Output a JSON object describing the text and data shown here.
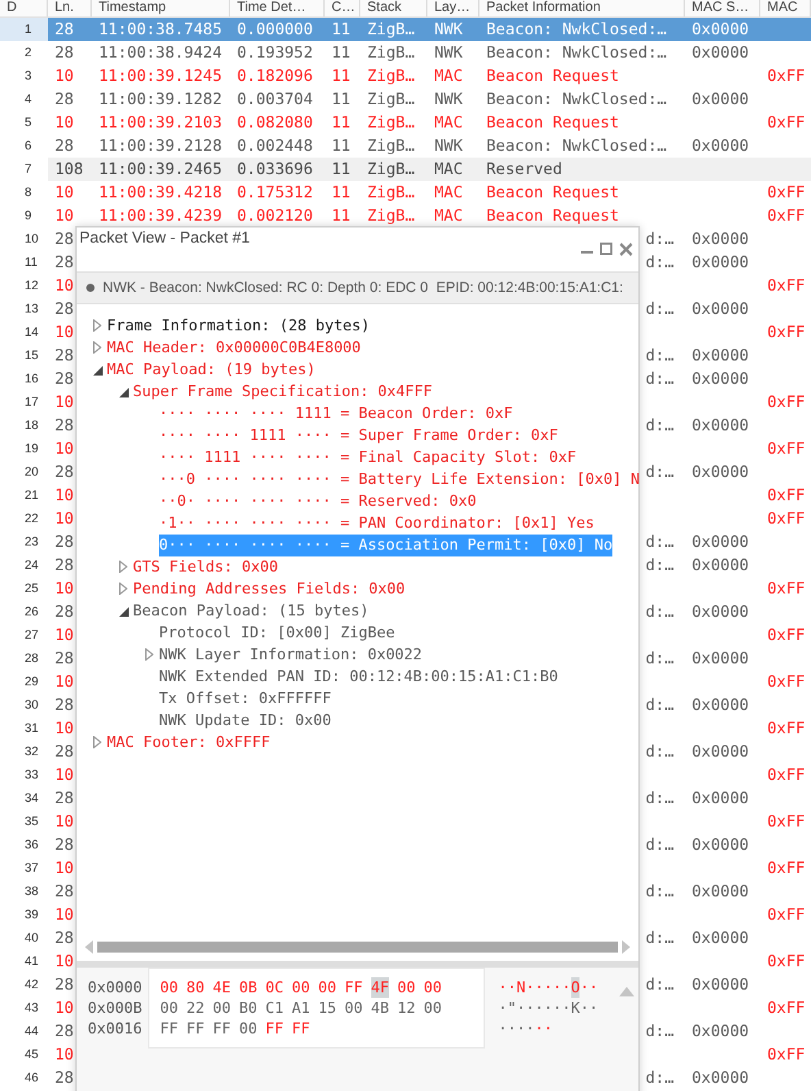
{
  "table": {
    "columns": [
      "D",
      "Ln.",
      "Timestamp",
      "Time Det…",
      "C…",
      "Stack",
      "Lay…",
      "Packet Information",
      "MAC S…",
      "MAC"
    ],
    "rows": [
      {
        "no": "1",
        "length": "28",
        "timestamp": "11:00:38.7485",
        "delta": "0.000000",
        "channel": "11",
        "stack": "ZigB…",
        "layer": "NWK",
        "info": "Beacon: NwkClosed:…",
        "mac_src": "0x0000",
        "kind": "beacon",
        "selected": true,
        "hovered": false
      },
      {
        "no": "2",
        "length": "28",
        "timestamp": "11:00:38.9424",
        "delta": "0.193952",
        "channel": "11",
        "stack": "ZigB…",
        "layer": "NWK",
        "info": "Beacon: NwkClosed:…",
        "mac_src": "0x0000",
        "kind": "beacon",
        "selected": false,
        "hovered": false
      },
      {
        "no": "3",
        "length": "10",
        "timestamp": "11:00:39.1245",
        "delta": "0.182096",
        "channel": "11",
        "stack": "ZigB…",
        "layer": "MAC",
        "info": "Beacon Request",
        "mac_dst": "0xFF",
        "kind": "request",
        "selected": false,
        "hovered": false
      },
      {
        "no": "4",
        "length": "28",
        "timestamp": "11:00:39.1282",
        "delta": "0.003704",
        "channel": "11",
        "stack": "ZigB…",
        "layer": "NWK",
        "info": "Beacon: NwkClosed:…",
        "mac_src": "0x0000",
        "kind": "beacon",
        "selected": false,
        "hovered": false
      },
      {
        "no": "5",
        "length": "10",
        "timestamp": "11:00:39.2103",
        "delta": "0.082080",
        "channel": "11",
        "stack": "ZigB…",
        "layer": "MAC",
        "info": "Beacon Request",
        "mac_dst": "0xFF",
        "kind": "request",
        "selected": false,
        "hovered": false
      },
      {
        "no": "6",
        "length": "28",
        "timestamp": "11:00:39.2128",
        "delta": "0.002448",
        "channel": "11",
        "stack": "ZigB…",
        "layer": "NWK",
        "info": "Beacon: NwkClosed:…",
        "mac_src": "0x0000",
        "kind": "beacon",
        "selected": false,
        "hovered": false
      },
      {
        "no": "7",
        "length": "108",
        "timestamp": "11:00:39.2465",
        "delta": "0.033696",
        "channel": "11",
        "stack": "ZigB…",
        "layer": "MAC",
        "info": "Reserved",
        "kind": "other",
        "selected": false,
        "hovered": true
      },
      {
        "no": "8",
        "length": "10",
        "timestamp": "11:00:39.4218",
        "delta": "0.175312",
        "channel": "11",
        "stack": "ZigB…",
        "layer": "MAC",
        "info": "Beacon Request",
        "mac_dst": "0xFF",
        "kind": "request",
        "selected": false,
        "hovered": false
      },
      {
        "no": "9",
        "length": "10",
        "timestamp": "11:00:39.4239",
        "delta": "0.002120",
        "channel": "11",
        "stack": "ZigB…",
        "layer": "MAC",
        "info": "Beacon Request",
        "mac_dst": "0xFF",
        "kind": "request",
        "selected": false,
        "hovered": false
      },
      {
        "no": "10",
        "length": "28",
        "info": "d:…",
        "mac_src": "0x0000",
        "kind": "beacon",
        "selected": false,
        "hovered": false
      },
      {
        "no": "11",
        "length": "28",
        "info": "d:…",
        "mac_src": "0x0000",
        "kind": "beacon",
        "selected": false,
        "hovered": false
      },
      {
        "no": "12",
        "length": "10",
        "mac_dst": "0xFF",
        "kind": "request",
        "selected": false,
        "hovered": false
      },
      {
        "no": "13",
        "length": "28",
        "info": "d:…",
        "mac_src": "0x0000",
        "kind": "beacon",
        "selected": false,
        "hovered": false
      },
      {
        "no": "14",
        "length": "10",
        "mac_dst": "0xFF",
        "kind": "request",
        "selected": false,
        "hovered": false
      },
      {
        "no": "15",
        "length": "28",
        "info": "d:…",
        "mac_src": "0x0000",
        "kind": "beacon",
        "selected": false,
        "hovered": false
      },
      {
        "no": "16",
        "length": "28",
        "info": "d:…",
        "mac_src": "0x0000",
        "kind": "beacon",
        "selected": false,
        "hovered": false
      },
      {
        "no": "17",
        "length": "10",
        "mac_dst": "0xFF",
        "kind": "request",
        "selected": false,
        "hovered": false
      },
      {
        "no": "18",
        "length": "28",
        "info": "d:…",
        "mac_src": "0x0000",
        "kind": "beacon",
        "selected": false,
        "hovered": false
      },
      {
        "no": "19",
        "length": "10",
        "mac_dst": "0xFF",
        "kind": "request",
        "selected": false,
        "hovered": false
      },
      {
        "no": "20",
        "length": "28",
        "info": "d:…",
        "mac_src": "0x0000",
        "kind": "beacon",
        "selected": false,
        "hovered": false
      },
      {
        "no": "21",
        "length": "10",
        "mac_dst": "0xFF",
        "kind": "request",
        "selected": false,
        "hovered": false
      },
      {
        "no": "22",
        "length": "10",
        "mac_dst": "0xFF",
        "kind": "request",
        "selected": false,
        "hovered": false
      },
      {
        "no": "23",
        "length": "28",
        "info": "d:…",
        "mac_src": "0x0000",
        "kind": "beacon",
        "selected": false,
        "hovered": false
      },
      {
        "no": "24",
        "length": "28",
        "info": "d:…",
        "mac_src": "0x0000",
        "kind": "beacon",
        "selected": false,
        "hovered": false
      },
      {
        "no": "25",
        "length": "10",
        "mac_dst": "0xFF",
        "kind": "request",
        "selected": false,
        "hovered": false
      },
      {
        "no": "26",
        "length": "28",
        "info": "d:…",
        "mac_src": "0x0000",
        "kind": "beacon",
        "selected": false,
        "hovered": false
      },
      {
        "no": "27",
        "length": "10",
        "mac_dst": "0xFF",
        "kind": "request",
        "selected": false,
        "hovered": false
      },
      {
        "no": "28",
        "length": "28",
        "info": "d:…",
        "mac_src": "0x0000",
        "kind": "beacon",
        "selected": false,
        "hovered": false
      },
      {
        "no": "29",
        "length": "10",
        "mac_dst": "0xFF",
        "kind": "request",
        "selected": false,
        "hovered": false
      },
      {
        "no": "30",
        "length": "28",
        "info": "d:…",
        "mac_src": "0x0000",
        "kind": "beacon",
        "selected": false,
        "hovered": false
      },
      {
        "no": "31",
        "length": "10",
        "mac_dst": "0xFF",
        "kind": "request",
        "selected": false,
        "hovered": false
      },
      {
        "no": "32",
        "length": "28",
        "info": "d:…",
        "mac_src": "0x0000",
        "kind": "beacon",
        "selected": false,
        "hovered": false
      },
      {
        "no": "33",
        "length": "10",
        "mac_dst": "0xFF",
        "kind": "request",
        "selected": false,
        "hovered": false
      },
      {
        "no": "34",
        "length": "28",
        "info": "d:…",
        "mac_src": "0x0000",
        "kind": "beacon",
        "selected": false,
        "hovered": false
      },
      {
        "no": "35",
        "length": "10",
        "mac_dst": "0xFF",
        "kind": "request",
        "selected": false,
        "hovered": false
      },
      {
        "no": "36",
        "length": "28",
        "info": "d:…",
        "mac_src": "0x0000",
        "kind": "beacon",
        "selected": false,
        "hovered": false
      },
      {
        "no": "37",
        "length": "10",
        "mac_dst": "0xFF",
        "kind": "request",
        "selected": false,
        "hovered": false
      },
      {
        "no": "38",
        "length": "28",
        "info": "d:…",
        "mac_src": "0x0000",
        "kind": "beacon",
        "selected": false,
        "hovered": false
      },
      {
        "no": "39",
        "length": "10",
        "mac_dst": "0xFF",
        "kind": "request",
        "selected": false,
        "hovered": false
      },
      {
        "no": "40",
        "length": "28",
        "info": "d:…",
        "mac_src": "0x0000",
        "kind": "beacon",
        "selected": false,
        "hovered": false
      },
      {
        "no": "41",
        "length": "10",
        "mac_dst": "0xFF",
        "kind": "request",
        "selected": false,
        "hovered": false
      },
      {
        "no": "42",
        "length": "28",
        "info": "d:…",
        "mac_src": "0x0000",
        "kind": "beacon",
        "selected": false,
        "hovered": false
      },
      {
        "no": "43",
        "length": "10",
        "mac_dst": "0xFF",
        "kind": "request",
        "selected": false,
        "hovered": false
      },
      {
        "no": "44",
        "length": "28",
        "info": "d:…",
        "mac_src": "0x0000",
        "kind": "beacon",
        "selected": false,
        "hovered": false
      },
      {
        "no": "45",
        "length": "10",
        "mac_dst": "0xFF",
        "kind": "request",
        "selected": false,
        "hovered": false
      },
      {
        "no": "46",
        "length": "28",
        "info": "d:…",
        "mac_src": "0x0000",
        "kind": "beacon",
        "selected": false,
        "hovered": false
      }
    ]
  },
  "packet_view": {
    "title": "Packet View - Packet #1",
    "summary": "NWK - Beacon: NwkClosed: RC 0: Depth 0: EDC 0  EPID: 00:12:4B:00:15:A1:C1:",
    "tree": [
      {
        "text": "Frame Information: (28 bytes)",
        "kind": "frame",
        "expanded": false,
        "selected": false
      },
      {
        "text": "MAC Header: 0x00000C0B4E8000",
        "kind": "field",
        "expanded": false,
        "selected": false
      },
      {
        "text": "MAC Payload: (19 bytes)",
        "kind": "field",
        "expanded": true,
        "selected": false,
        "children": [
          {
            "text": "Super Frame Specification: 0x4FFF",
            "kind": "field",
            "expanded": true,
            "selected": false,
            "children": [
              {
                "text": "···· ···· ···· 1111 = Beacon Order: 0xF",
                "kind": "field",
                "selected": false
              },
              {
                "text": "···· ···· 1111 ···· = Super Frame Order: 0xF",
                "kind": "field",
                "selected": false
              },
              {
                "text": "···· 1111 ···· ···· = Final Capacity Slot: 0xF",
                "kind": "field",
                "selected": false
              },
              {
                "text": "···0 ···· ···· ···· = Battery Life Extension: [0x0] N",
                "kind": "field",
                "selected": false
              },
              {
                "text": "··0· ···· ···· ···· = Reserved: 0x0",
                "kind": "field",
                "selected": false
              },
              {
                "text": "·1·· ···· ···· ···· = PAN Coordinator: [0x1] Yes",
                "kind": "field",
                "selected": false
              },
              {
                "text": "0··· ···· ···· ···· = Association Permit: [0x0] No",
                "kind": "field",
                "selected": true
              }
            ]
          },
          {
            "text": "GTS Fields: 0x00",
            "kind": "field",
            "expanded": false,
            "selected": false
          },
          {
            "text": "Pending Addresses Fields: 0x00",
            "kind": "field",
            "expanded": false,
            "selected": false
          },
          {
            "text": "Beacon Payload: (15 bytes)",
            "kind": "payload",
            "expanded": true,
            "selected": false,
            "children": [
              {
                "text": "Protocol ID: [0x00] ZigBee",
                "kind": "payload",
                "selected": false
              },
              {
                "text": "NWK Layer Information: 0x0022",
                "kind": "payload",
                "expanded": false,
                "selected": false
              },
              {
                "text": "NWK Extended PAN ID: 00:12:4B:00:15:A1:C1:B0",
                "kind": "payload",
                "selected": false
              },
              {
                "text": "Tx Offset: 0xFFFFFF",
                "kind": "payload",
                "selected": false
              },
              {
                "text": "NWK Update ID: 0x00",
                "kind": "payload",
                "selected": false
              }
            ]
          }
        ]
      },
      {
        "text": "MAC Footer: 0xFFFF",
        "kind": "field",
        "expanded": false,
        "selected": false
      }
    ],
    "hex": [
      {
        "offset": "0x0000",
        "bytes": [
          {
            "hex": "00",
            "ascii": "·",
            "marked": true,
            "selected": false
          },
          {
            "hex": "80",
            "ascii": "·",
            "marked": true,
            "selected": false
          },
          {
            "hex": "4E",
            "ascii": "N",
            "marked": true,
            "selected": false
          },
          {
            "hex": "0B",
            "ascii": "·",
            "marked": true,
            "selected": false
          },
          {
            "hex": "0C",
            "ascii": "·",
            "marked": true,
            "selected": false
          },
          {
            "hex": "00",
            "ascii": "·",
            "marked": true,
            "selected": false
          },
          {
            "hex": "00",
            "ascii": "·",
            "marked": true,
            "selected": false
          },
          {
            "hex": "FF",
            "ascii": "·",
            "marked": true,
            "selected": false
          },
          {
            "hex": "4F",
            "ascii": "O",
            "marked": true,
            "selected": true
          },
          {
            "hex": "00",
            "ascii": "·",
            "marked": true,
            "selected": false
          },
          {
            "hex": "00",
            "ascii": "·",
            "marked": true,
            "selected": false
          }
        ]
      },
      {
        "offset": "0x000B",
        "bytes": [
          {
            "hex": "00",
            "ascii": "·",
            "marked": false,
            "selected": false
          },
          {
            "hex": "22",
            "ascii": "\"",
            "marked": false,
            "selected": false
          },
          {
            "hex": "00",
            "ascii": "·",
            "marked": false,
            "selected": false
          },
          {
            "hex": "B0",
            "ascii": "·",
            "marked": false,
            "selected": false
          },
          {
            "hex": "C1",
            "ascii": "·",
            "marked": false,
            "selected": false
          },
          {
            "hex": "A1",
            "ascii": "·",
            "marked": false,
            "selected": false
          },
          {
            "hex": "15",
            "ascii": "·",
            "marked": false,
            "selected": false
          },
          {
            "hex": "00",
            "ascii": "·",
            "marked": false,
            "selected": false
          },
          {
            "hex": "4B",
            "ascii": "K",
            "marked": false,
            "selected": false
          },
          {
            "hex": "12",
            "ascii": "·",
            "marked": false,
            "selected": false
          },
          {
            "hex": "00",
            "ascii": "·",
            "marked": false,
            "selected": false
          }
        ]
      },
      {
        "offset": "0x0016",
        "bytes": [
          {
            "hex": "FF",
            "ascii": "·",
            "marked": false,
            "selected": false
          },
          {
            "hex": "FF",
            "ascii": "·",
            "marked": false,
            "selected": false
          },
          {
            "hex": "FF",
            "ascii": "·",
            "marked": false,
            "selected": false
          },
          {
            "hex": "00",
            "ascii": "·",
            "marked": false,
            "selected": false
          },
          {
            "hex": "FF",
            "ascii": "·",
            "marked": true,
            "selected": false
          },
          {
            "hex": "FF",
            "ascii": "·",
            "marked": true,
            "selected": false
          }
        ]
      }
    ]
  }
}
